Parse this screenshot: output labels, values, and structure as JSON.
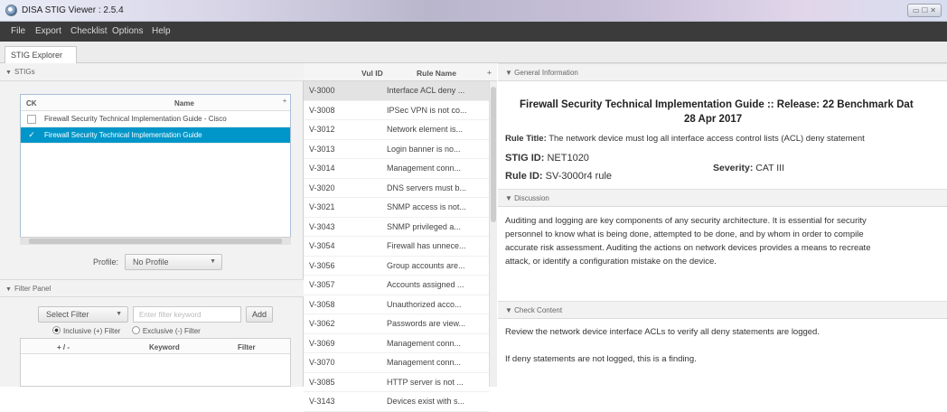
{
  "window": {
    "title": "DISA STIG Viewer : 2.5.4",
    "controls": "▭ ☐ ✕"
  },
  "menu": [
    "File",
    "Export",
    "Checklist",
    "Options",
    "Help"
  ],
  "tab": "STIG Explorer",
  "stigs_panel": {
    "title": "STIGs",
    "columns": {
      "ck": "CK",
      "name": "Name"
    },
    "rows": [
      {
        "checked": false,
        "name": "Firewall Security Technical Implementation Guide - Cisco"
      },
      {
        "checked": true,
        "name": "Firewall Security Technical Implementation Guide"
      }
    ],
    "profile_label": "Profile:",
    "profile_value": "No Profile"
  },
  "filter_panel": {
    "title": "Filter Panel",
    "select_filter": "Select Filter",
    "keyword_placeholder": "Enter filter keyword",
    "add_label": "Add",
    "inclusive_label": "Inclusive (+) Filter",
    "exclusive_label": "Exclusive (-) Filter",
    "columns": {
      "plusminus": "+ / -",
      "keyword": "Keyword",
      "filter": "Filter"
    }
  },
  "rules": {
    "columns": {
      "id": "Vul ID",
      "name": "Rule Name"
    },
    "rows": [
      {
        "id": "V-3000",
        "name": "Interface ACL deny ..."
      },
      {
        "id": "V-3008",
        "name": "IPSec VPN is not co..."
      },
      {
        "id": "V-3012",
        "name": "Network element is..."
      },
      {
        "id": "V-3013",
        "name": "Login banner is no..."
      },
      {
        "id": "V-3014",
        "name": "Management conn..."
      },
      {
        "id": "V-3020",
        "name": "DNS servers must b..."
      },
      {
        "id": "V-3021",
        "name": "SNMP access is not..."
      },
      {
        "id": "V-3043",
        "name": "SNMP privileged a..."
      },
      {
        "id": "V-3054",
        "name": "Firewall has unnece..."
      },
      {
        "id": "V-3056",
        "name": "Group accounts are..."
      },
      {
        "id": "V-3057",
        "name": "Accounts assigned ..."
      },
      {
        "id": "V-3058",
        "name": "Unauthorized acco..."
      },
      {
        "id": "V-3062",
        "name": "Passwords are view..."
      },
      {
        "id": "V-3069",
        "name": "Management conn..."
      },
      {
        "id": "V-3070",
        "name": "Management conn..."
      },
      {
        "id": "V-3085",
        "name": "HTTP server is not ..."
      },
      {
        "id": "V-3143",
        "name": "Devices exist with s..."
      }
    ]
  },
  "general_info": {
    "title": "General Information",
    "heading_line1": "Firewall Security Technical Implementation Guide :: Release: 22 Benchmark Dat",
    "heading_line2": "28 Apr 2017",
    "rule_title_label": "Rule Title:",
    "rule_title": "The network device must log all interface access control lists (ACL) deny statement",
    "stig_id_label": "STIG ID:",
    "stig_id": "NET1020",
    "rule_id_label": "Rule ID:",
    "rule_id": "SV-3000r4 rule",
    "severity_label": "Severity:",
    "severity": "CAT III"
  },
  "discussion": {
    "title": "Discussion",
    "lines": [
      "Auditing and logging are key components of any security architecture. It is essential for security",
      "personnel to know what is being done, attempted to be done, and by whom in order to compile",
      "accurate risk assessment. Auditing the actions on network devices provides a means to recreate",
      "attack, or identify a configuration mistake on the device."
    ]
  },
  "check_content": {
    "title": "Check Content",
    "line1": "Review the network device interface ACLs to verify all deny statements are logged.",
    "line2": "If deny statements are not logged, this is a finding."
  }
}
